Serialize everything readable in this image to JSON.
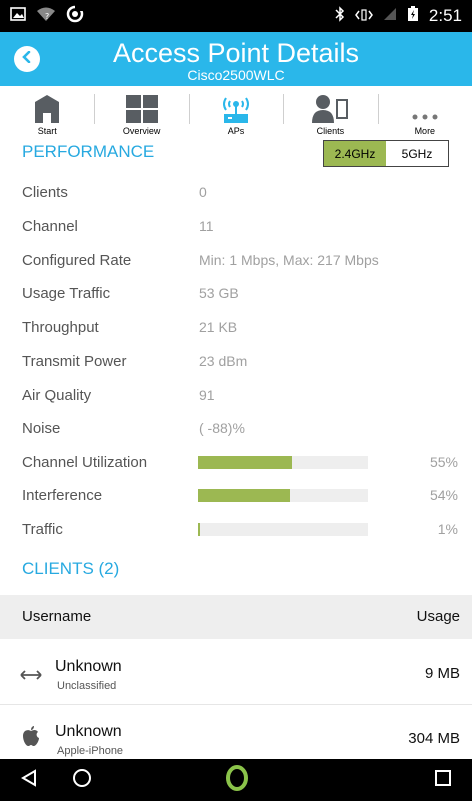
{
  "status_bar": {
    "time": "2:51",
    "icons": [
      "image-icon",
      "wifi-icon",
      "sync-icon",
      "bluetooth-icon",
      "vibrate-icon",
      "no-sim-icon",
      "battery-icon"
    ]
  },
  "header": {
    "title": "Access Point Details",
    "subtitle": "Cisco2500WLC",
    "back_icon": "chevron-left-icon"
  },
  "tabs": [
    {
      "label": "Start",
      "icon": "home-icon"
    },
    {
      "label": "Overview",
      "icon": "grid-icon"
    },
    {
      "label": "APs",
      "icon": "access-point-icon",
      "active": true
    },
    {
      "label": "Clients",
      "icon": "person-device-icon"
    },
    {
      "label": "More",
      "icon": "more-dots-icon"
    }
  ],
  "performance": {
    "title": "PERFORMANCE",
    "bands": [
      "2.4GHz",
      "5GHz"
    ],
    "selected_band": "2.4GHz",
    "rows": [
      {
        "label": "Clients",
        "value": "0"
      },
      {
        "label": "Channel",
        "value": "11"
      },
      {
        "label": "Configured Rate",
        "value": "Min: 1 Mbps, Max: 217 Mbps"
      },
      {
        "label": "Usage Traffic",
        "value": "53 GB"
      },
      {
        "label": "Throughput",
        "value": "21 KB"
      },
      {
        "label": "Transmit Power",
        "value": "23 dBm"
      },
      {
        "label": "Air Quality",
        "value": "91"
      },
      {
        "label": "Noise",
        "value": "( -88)%"
      }
    ],
    "bars": [
      {
        "label": "Channel Utilization",
        "percent": 55,
        "percent_text": "55%"
      },
      {
        "label": "Interference",
        "percent": 54,
        "percent_text": "54%"
      },
      {
        "label": "Traffic",
        "percent": 1,
        "percent_text": "1%"
      }
    ]
  },
  "clients": {
    "title": "CLIENTS (2)",
    "columns": {
      "username": "Username",
      "usage": "Usage"
    },
    "items": [
      {
        "name": "Unknown",
        "type": "Unclassified",
        "usage": "9 MB",
        "icon": "arrows-horizontal-icon"
      },
      {
        "name": "Unknown",
        "type": "Apple-iPhone",
        "usage": "304 MB",
        "icon": "apple-icon"
      }
    ]
  },
  "colors": {
    "accent": "#2ab7ea",
    "section_title": "#27a9e0",
    "bar_fill": "#9cb852",
    "bar_track": "#eeeeee",
    "nav_home": "#8bc34a"
  }
}
